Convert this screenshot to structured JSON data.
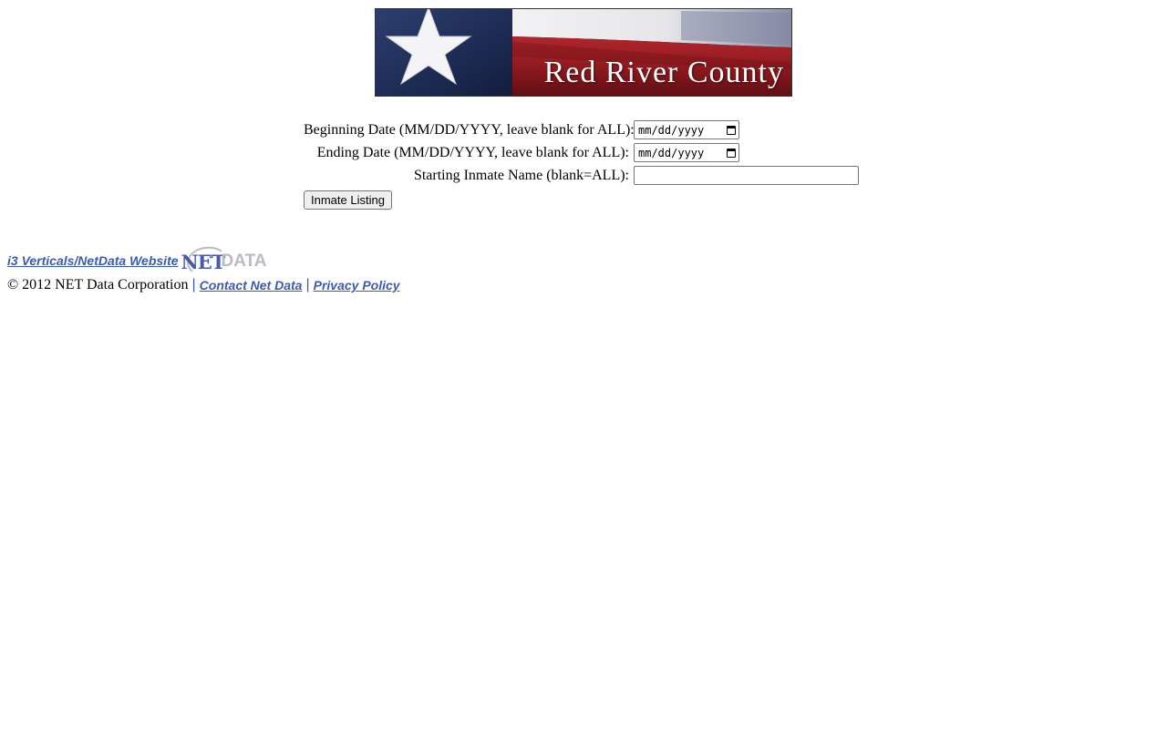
{
  "banner": {
    "title": "Red River County"
  },
  "form": {
    "begin_label": "Beginning Date (MM/DD/YYYY, leave blank for ALL):",
    "begin_placeholder": "mm/dd/yyyy",
    "end_label": "Ending Date (MM/DD/YYYY, leave blank for ALL):",
    "end_placeholder": "mm/dd/yyyy",
    "name_label": "Starting Inmate Name (blank=ALL):",
    "name_value": "",
    "submit_label": "Inmate Listing"
  },
  "footer": {
    "website_link": "i3 Verticals/NetData Website",
    "logo_net": "NET",
    "logo_data": "DATA",
    "copyright": "© 2012 NET Data Corporation",
    "separator": "|",
    "contact_link": "Contact Net Data",
    "privacy_link": "Privacy Policy"
  },
  "colors": {
    "link": "#3b5ab5",
    "flag_blue": "#1f2f5a",
    "flag_red": "#9c1c22",
    "flag_white": "#e8e8ee"
  }
}
